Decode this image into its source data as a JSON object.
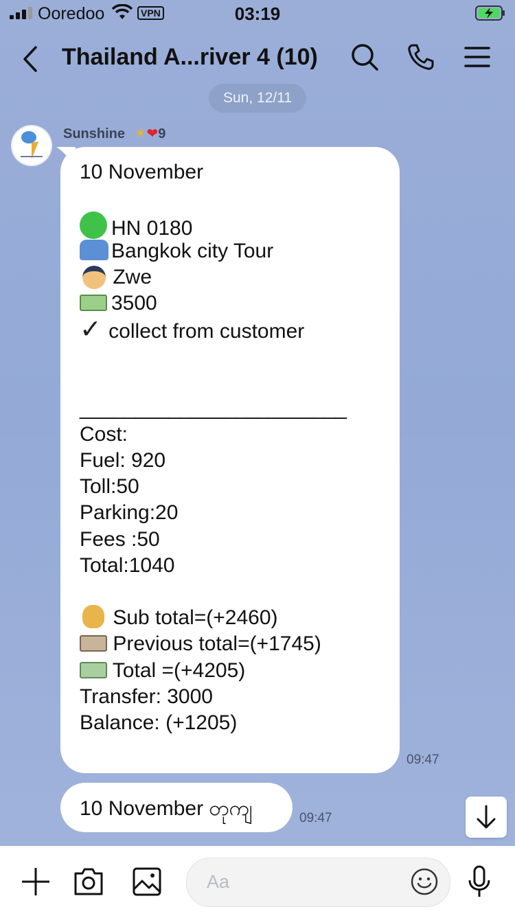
{
  "status": {
    "carrier": "Ooredoo",
    "vpn": "VPN",
    "time": "03:19"
  },
  "header": {
    "title": "Thailand A...river 4 (10)"
  },
  "date_pill": "Sun, 12/11",
  "sender": {
    "name": "Sunshine",
    "badge_count": "9"
  },
  "message1": {
    "lines": [
      "10 November",
      "",
      "HN 0180",
      "Bangkok city Tour",
      " Zwe",
      "3500",
      " collect from customer",
      "",
      "",
      "________________________",
      "Cost:",
      "Fuel: 920",
      "Toll:50",
      "Parking:20",
      "Fees :50",
      "Total:1040",
      "",
      " Sub total=(+2460)",
      "  Previous total=(+1745)",
      "  Total =(+4205)",
      "Transfer: 3000",
      "Balance: (+1205)"
    ],
    "timestamp": "09:47"
  },
  "message2": {
    "text": "10 November တုကျ",
    "timestamp": "09:47"
  },
  "input": {
    "placeholder": "Aa"
  },
  "colors": {
    "background": "#96abd6",
    "bubble": "#ffffff",
    "date_pill": "#8ea1c8"
  }
}
